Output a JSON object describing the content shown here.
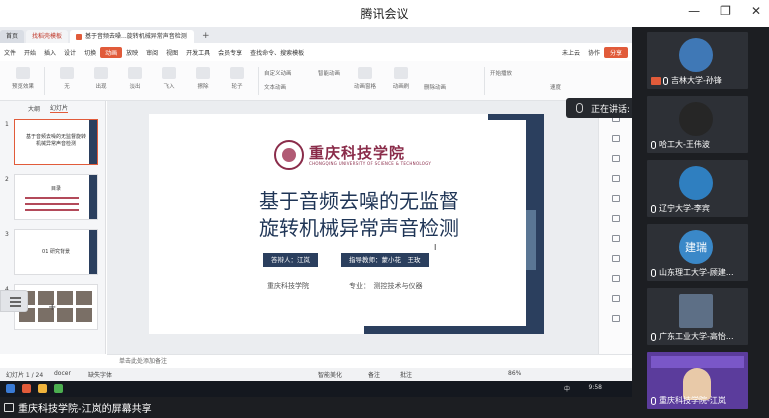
{
  "window": {
    "title": "腾讯会议"
  },
  "wps": {
    "tabs": [
      {
        "label": "首页"
      },
      {
        "label": "找稻壳模板"
      },
      {
        "label": "基于音频去噪...旋转机械异常声音检测"
      }
    ],
    "menu": [
      "文件",
      "开始",
      "插入",
      "设计",
      "切换",
      "动画",
      "放映",
      "审阅",
      "视图",
      "开发工具",
      "会员专享",
      "查找命令、搜索模板",
      "未上云",
      "协作",
      "分享"
    ],
    "active_menu": "动画",
    "ribbon": {
      "preview": "预览效果",
      "none": "无",
      "appear": "出现",
      "fade": "淡出",
      "fly_in": "飞入",
      "erase": "擦除",
      "wheel": "轮子",
      "custom_animation": "自定义动画",
      "text_animation": "文本动画",
      "smart_animation": "智能动画",
      "animation_window": "动画窗格",
      "animation_brush": "动画刷",
      "delete_animation": "删除动画",
      "start_animation": "开始播放",
      "speed": "速度"
    },
    "leftpane": {
      "tabs": [
        "大纲",
        "幻灯片"
      ],
      "thumbs": [
        {
          "num": "1",
          "caption": "基于音频去噪的无监督旋转机械异常声音检测"
        },
        {
          "num": "2",
          "caption": "目录"
        },
        {
          "num": "3",
          "caption": "01 研究背景"
        },
        {
          "num": "4",
          "caption": ""
        }
      ]
    },
    "slide": {
      "school_cn": "重庆科技学院",
      "school_en": "CHONGQING UNIVERSITY OF SCIENCE & TECHNOLOGY",
      "title_line1": "基于音频去噪的无监督",
      "title_line2": "旋转机械异常声音检测",
      "respondent": "答辩人：江岚",
      "advisor": "指导教师：蒙小花　王玫",
      "school_short": "重庆科技学院",
      "major": "专业：　测控技术与仪器"
    },
    "notes": "单击此处添加备注",
    "status": {
      "page": "幻灯片 1 / 24",
      "docer": "docer",
      "font_missing": "缺失字体",
      "smart_beautify": "智能美化",
      "notes_btn": "备注",
      "comment_btn": "批注",
      "zoom": "86%",
      "input_method": "中",
      "clock": "9:58"
    }
  },
  "meeting": {
    "now_speaking": "正在讲话:",
    "bottom_label": "重庆科技学院-江岚的屏幕共享",
    "participants": [
      {
        "name": "吉林大学-孙锋",
        "avatar": ""
      },
      {
        "name": "哈工大-王伟波",
        "avatar": ""
      },
      {
        "name": "辽宁大学-李宾",
        "avatar": ""
      },
      {
        "name": "山东理工大学-顾建...",
        "avatar": "建瑞"
      },
      {
        "name": "广东工业大学-高怡...",
        "avatar": ""
      },
      {
        "name": "重庆科技学院-江岚",
        "avatar": ""
      }
    ]
  },
  "colors": {
    "accent": "#e15b3a",
    "navy": "#2b3f5e",
    "maroon": "#8a2c4a"
  }
}
